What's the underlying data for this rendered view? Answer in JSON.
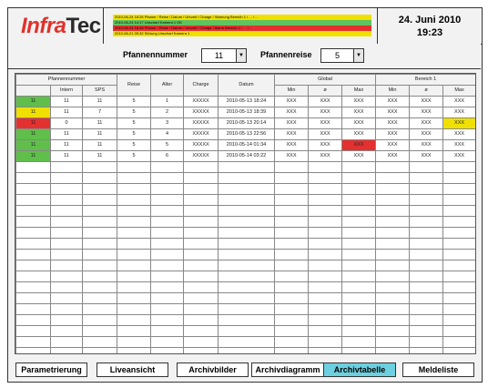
{
  "logo": {
    "part1": "Infra",
    "part2": "Tec"
  },
  "alarms": [
    {
      "text": "2010-06-24 18:26   Pfanne / Reise / Datum / Uhrzeit / Charge / Warnung Bereich 1 / ... / ...",
      "color": "#f0e000"
    },
    {
      "text": "2010-06-24 14:17   Unscharf Kamera 1 OK",
      "color": "#5fc35f"
    },
    {
      "text": "2010-06-24 18:48   Pfanne / Reise / Datum / Uhrzeit / Charge / Alarm Bereich 1 / ... / ...",
      "color": "#e53030"
    },
    {
      "text": "2010-06-21 09:32   Störung Unscharf Kamera 1",
      "color": "#f0e000"
    }
  ],
  "header": {
    "date": "24. Juni 2010",
    "time": "19:23"
  },
  "selectors": {
    "pfannennummer_label": "Pfannennummer",
    "pfannennummer_value": "11",
    "pfannenreise_label": "Pfannenreise",
    "pfannenreise_value": "5"
  },
  "table": {
    "group_headers": {
      "pfannennummer": "Pfannennummer",
      "global": "Global",
      "bereich": "Bereich 1"
    },
    "columns": {
      "intern": "Intern",
      "sps": "SPS",
      "reise": "Reise",
      "alter": "Alter",
      "charge": "Charge",
      "datum": "Datum",
      "min": "Min",
      "avg": "ø",
      "max": "Max"
    },
    "rows": [
      {
        "status": "11",
        "status_color": "#5fbf4a",
        "intern": "11",
        "sps": "11",
        "reise": "5",
        "alter": "1",
        "charge": "XXXXX",
        "datum": "2010-05-13 18:24",
        "g_min": "XXX",
        "g_avg": "XXX",
        "g_max": "XXX",
        "g_max_color": "",
        "b_min": "XXX",
        "b_avg": "XXX",
        "b_max": "XXX",
        "b_max_color": ""
      },
      {
        "status": "11",
        "status_color": "#f0e000",
        "intern": "11",
        "sps": "7",
        "reise": "5",
        "alter": "2",
        "charge": "XXXXX",
        "datum": "2010-05-13 18:39",
        "g_min": "XXX",
        "g_avg": "XXX",
        "g_max": "XXX",
        "g_max_color": "",
        "b_min": "XXX",
        "b_avg": "XXX",
        "b_max": "XXX",
        "b_max_color": ""
      },
      {
        "status": "11",
        "status_color": "#e53030",
        "intern": "0",
        "sps": "11",
        "reise": "5",
        "alter": "3",
        "charge": "XXXXX",
        "datum": "2010-05-13 20:14",
        "g_min": "XXX",
        "g_avg": "XXX",
        "g_max": "XXX",
        "g_max_color": "",
        "b_min": "XXX",
        "b_avg": "XXX",
        "b_max": "XXX",
        "b_max_color": "#f0e000"
      },
      {
        "status": "11",
        "status_color": "#5fbf4a",
        "intern": "11",
        "sps": "11",
        "reise": "5",
        "alter": "4",
        "charge": "XXXXX",
        "datum": "2010-05-13 22:56",
        "g_min": "XXX",
        "g_avg": "XXX",
        "g_max": "XXX",
        "g_max_color": "",
        "b_min": "XXX",
        "b_avg": "XXX",
        "b_max": "XXX",
        "b_max_color": ""
      },
      {
        "status": "11",
        "status_color": "#5fbf4a",
        "intern": "11",
        "sps": "11",
        "reise": "5",
        "alter": "5",
        "charge": "XXXXX",
        "datum": "2010-05-14 01:34",
        "g_min": "XXX",
        "g_avg": "XXX",
        "g_max": "XXX",
        "g_max_color": "#e53030",
        "b_min": "XXX",
        "b_avg": "XXX",
        "b_max": "XXX",
        "b_max_color": ""
      },
      {
        "status": "11",
        "status_color": "#5fbf4a",
        "intern": "11",
        "sps": "11",
        "reise": "5",
        "alter": "6",
        "charge": "XXXXX",
        "datum": "2010-05-14 03:22",
        "g_min": "XXX",
        "g_avg": "XXX",
        "g_max": "XXX",
        "g_max_color": "",
        "b_min": "XXX",
        "b_avg": "XXX",
        "b_max": "XXX",
        "b_max_color": ""
      }
    ]
  },
  "nav": {
    "parametrierung": "Parametrierung",
    "liveansicht": "Liveansicht",
    "archivbilder": "Archivbilder",
    "archivdiagramm": "Archivdiagramm",
    "archivtabelle": "Archivtabelle",
    "meldeliste": "Meldeliste"
  }
}
